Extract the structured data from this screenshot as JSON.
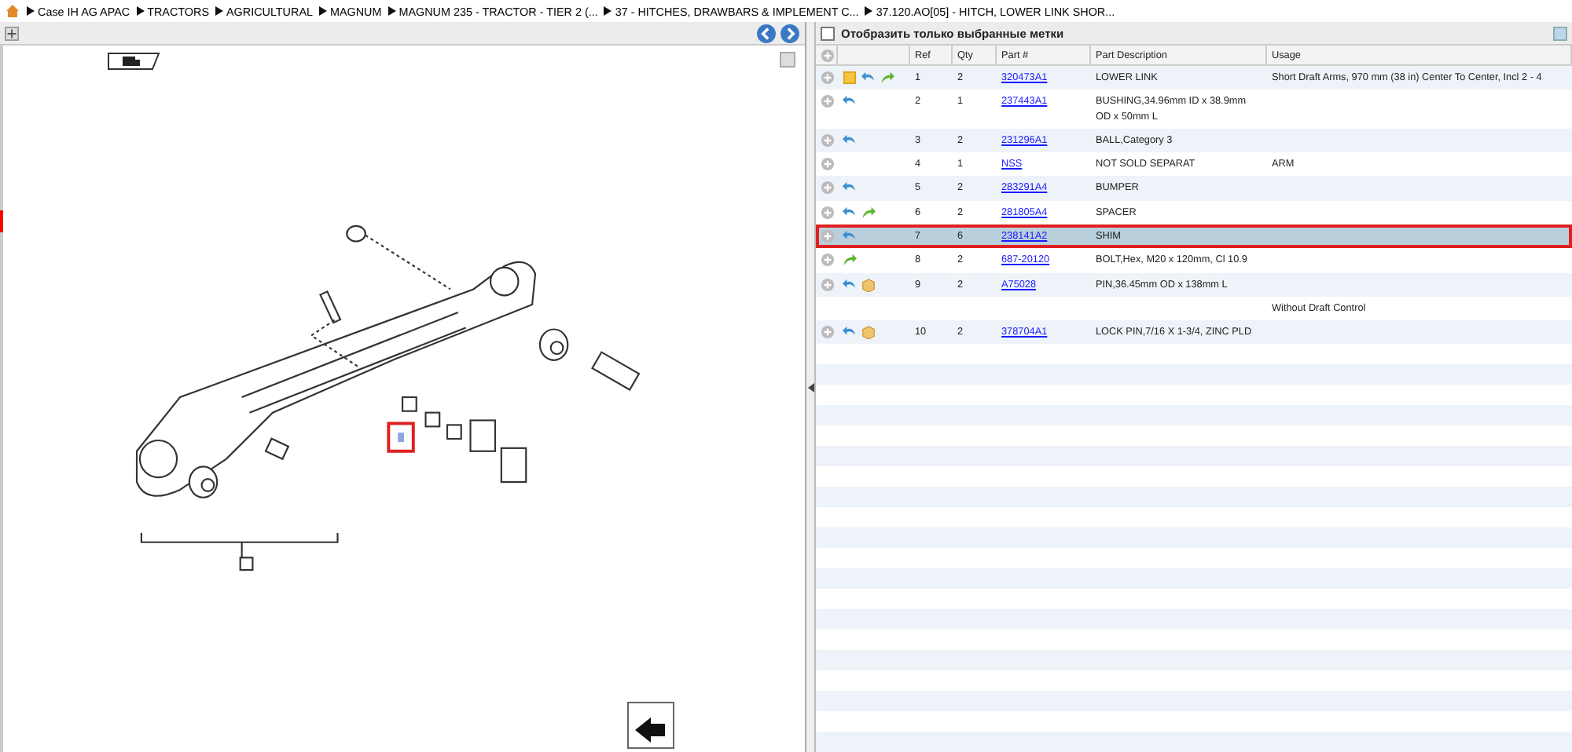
{
  "breadcrumb": [
    "Case IH AG APAC",
    "TRACTORS",
    "AGRICULTURAL",
    "MAGNUM",
    "MAGNUM 235 - TRACTOR - TIER 2 (...",
    "37 - HITCHES, DRAWBARS & IMPLEMENT C...",
    "37.120.AO[05] - HITCH, LOWER LINK SHOR..."
  ],
  "filter": {
    "label": "Отобразить только выбранные метки",
    "checked": false
  },
  "columns": [
    "Ref",
    "Qty",
    "Part #",
    "Part Description",
    "Usage"
  ],
  "rows": [
    {
      "icons": [
        {
          "kind": "note"
        },
        {
          "kind": "blue"
        },
        {
          "kind": "green"
        }
      ],
      "ref": "1",
      "qty": "2",
      "part": "320473A1",
      "description": "LOWER LINK",
      "usage": "Short Draft Arms, 970 mm (38 in) Center To Center, Incl 2 - 4",
      "selected": false
    },
    {
      "icons": [
        {
          "kind": "blue"
        }
      ],
      "ref": "2",
      "qty": "1",
      "part": "237443A1",
      "description": "BUSHING,34.96mm ID x 38.9mm OD x 50mm L",
      "selected": false
    },
    {
      "icons": [
        {
          "kind": "blue"
        }
      ],
      "ref": "3",
      "qty": "2",
      "part": "231296A1",
      "description": "BALL,Category 3",
      "selected": false
    },
    {
      "ref": "4",
      "qty": "1",
      "part": "NSS",
      "description": "NOT SOLD SEPARAT",
      "usage": "ARM",
      "selected": false
    },
    {
      "icons": [
        {
          "kind": "blue"
        }
      ],
      "ref": "5",
      "qty": "2",
      "part": "283291A4",
      "description": "BUMPER",
      "selected": false
    },
    {
      "icons": [
        {
          "kind": "blue"
        },
        {
          "kind": "green"
        }
      ],
      "ref": "6",
      "qty": "2",
      "part": "281805A4",
      "description": "SPACER",
      "selected": false
    },
    {
      "icons": [
        {
          "kind": "blue"
        }
      ],
      "ref": "7",
      "qty": "6",
      "part": "238141A2",
      "description": "SHIM",
      "selected": true
    },
    {
      "icons": [
        {
          "kind": "green"
        }
      ],
      "ref": "8",
      "qty": "2",
      "part": "687-20120",
      "description": "BOLT,Hex, M20 x 120mm, Cl 10.9",
      "selected": false
    },
    {
      "icons": [
        {
          "kind": "blue"
        },
        {
          "kind": "box"
        }
      ],
      "ref": "9",
      "qty": "2",
      "part": "A75028",
      "description": "PIN,36.45mm OD x 138mm L",
      "selected": false
    },
    {
      "usage": "Without Draft Control",
      "selected": false
    },
    {
      "icons": [
        {
          "kind": "blue"
        },
        {
          "kind": "box"
        }
      ],
      "ref": "10",
      "qty": "2",
      "part": "378704A1",
      "description": "LOCK PIN,7/16 X 1-3/4, ZINC PLD",
      "selected": false
    }
  ]
}
